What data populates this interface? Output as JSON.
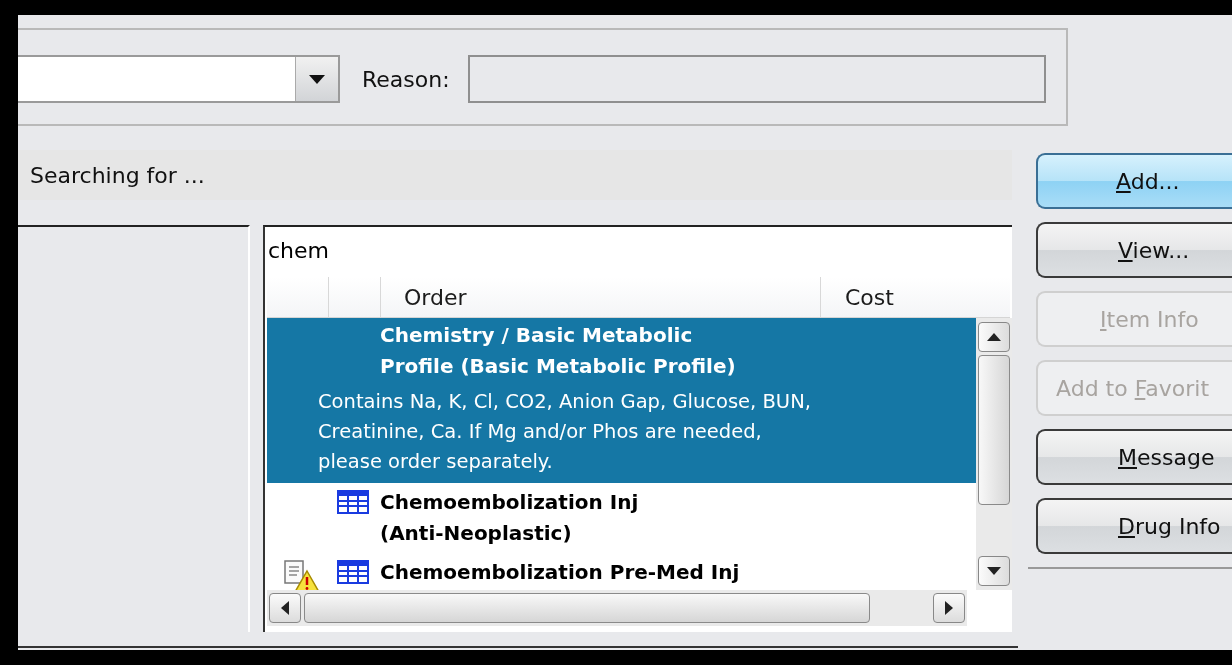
{
  "order_bar": {
    "reason": {
      "label": "Reason:"
    }
  },
  "status": "Searching for ...",
  "search": {
    "value": "chem"
  },
  "columns": [
    {
      "label": "Order"
    },
    {
      "label": "Cost"
    }
  ],
  "orders": [
    {
      "kind": "order",
      "warning": false,
      "selected": true,
      "title_lines": [
        "Chemistry / Basic Metabolic",
        "Profile (Basic Metabolic Profile)"
      ],
      "description_lines": [
        "Contains Na, K, Cl, CO2, Anion Gap, Glucose, BUN,",
        "Creatinine, Ca.  If Mg and/or Phos are needed,",
        "please order separately."
      ]
    },
    {
      "kind": "order_set",
      "warning": false,
      "selected": false,
      "title_lines": [
        "Chemoembolization Inj",
        "(Anti-Neoplastic)"
      ]
    },
    {
      "kind": "order_set",
      "warning": true,
      "selected": false,
      "title_lines": [
        "Chemoembolization Pre-Med Inj"
      ]
    }
  ],
  "buttons": [
    {
      "label": {
        "mnemonic": "A",
        "rest": "dd..."
      },
      "default": true,
      "disabled": false
    },
    {
      "label": {
        "mnemonic": "V",
        "rest": "iew..."
      },
      "default": false,
      "disabled": false
    },
    {
      "label": {
        "mnemonic": "I",
        "rest": "tem Info"
      },
      "default": false,
      "disabled": true
    },
    {
      "label": {
        "prefix": "Add to ",
        "mnemonic": "F",
        "rest": "avorit"
      },
      "default": false,
      "disabled": true
    },
    {
      "label": {
        "mnemonic": "M",
        "rest": "essage"
      },
      "default": false,
      "disabled": false
    },
    {
      "label": {
        "mnemonic": "D",
        "rest": "rug Info"
      },
      "default": false,
      "disabled": false
    }
  ]
}
